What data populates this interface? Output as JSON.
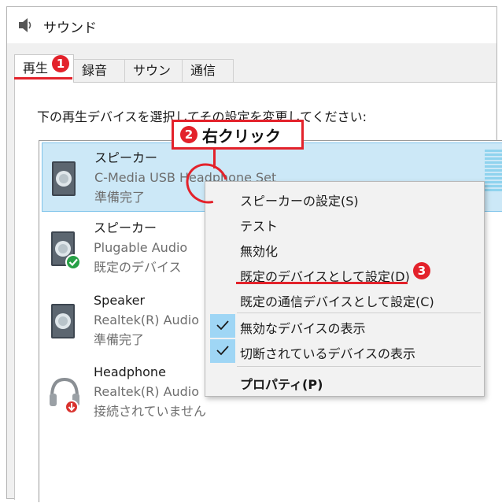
{
  "window": {
    "title": "サウンド",
    "icon": "speaker-icon"
  },
  "tabs": [
    {
      "label": "再生",
      "active": true
    },
    {
      "label": "録音",
      "active": false
    },
    {
      "label": "サウンド",
      "active": false
    },
    {
      "label": "通信",
      "active": false
    }
  ],
  "instruction": "下の再生デバイスを選択してその設定を変更してください:",
  "devices": [
    {
      "name": "スピーカー",
      "driver": "C-Media USB Headphone Set",
      "status": "準備完了",
      "icon": "speaker-icon",
      "selected": true
    },
    {
      "name": "スピーカー",
      "driver": "Plugable Audio",
      "status": "既定のデバイス",
      "icon": "speaker-default-icon",
      "selected": false
    },
    {
      "name": "Speaker",
      "driver": "Realtek(R) Audio",
      "status": "準備完了",
      "icon": "speaker-icon",
      "selected": false
    },
    {
      "name": "Headphone",
      "driver": "Realtek(R) Audio",
      "status": "接続されていません",
      "icon": "headphone-disconnected-icon",
      "selected": false
    }
  ],
  "context_menu": {
    "items": [
      {
        "label": "スピーカーの設定(S)"
      },
      {
        "label": "テスト"
      },
      {
        "label": "無効化"
      },
      {
        "label": "既定のデバイスとして設定(D)"
      },
      {
        "label": "既定の通信デバイスとして設定(C)"
      },
      {
        "label": "無効なデバイスの表示",
        "checked": true
      },
      {
        "label": "切断されているデバイスの表示",
        "checked": true
      },
      {
        "label": "プロパティ(P)",
        "bold": true
      }
    ]
  },
  "annotations": {
    "step1": "1",
    "step2": "2",
    "step2_label": "右クリック",
    "step3": "3",
    "color": "#e3222b"
  },
  "colors": {
    "selection": "#cce8f7",
    "check_bg": "#9fd6f5",
    "accent": "#e3222b"
  }
}
